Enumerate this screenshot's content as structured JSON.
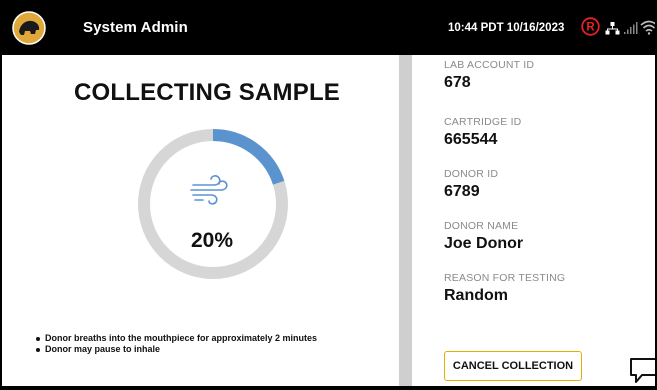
{
  "header": {
    "title": "System Admin",
    "datetime": "10:44 PDT 10/16/2023",
    "status_badge": "R",
    "icons": [
      "logo-icon",
      "registered-status-icon",
      "network-icon",
      "signal-icon",
      "wifi-icon"
    ],
    "colors": {
      "bar": "#000000",
      "badge": "#e52222"
    }
  },
  "collection": {
    "heading": "COLLECTING SAMPLE",
    "progress": 0.2,
    "progress_label": "20%",
    "ring_colors": {
      "fill": "#5b93cf",
      "track": "#d6d6d6"
    },
    "icon": "breath-wind-icon",
    "instructions": [
      "Donor breaths into the mouthpiece for approximately 2 minutes",
      "Donor may pause to inhale"
    ]
  },
  "details": [
    {
      "label": "LAB ACCOUNT ID",
      "value": "678"
    },
    {
      "label": "CARTRIDGE ID",
      "value": "665544"
    },
    {
      "label": "DONOR ID",
      "value": "6789"
    },
    {
      "label": "DONOR NAME",
      "value": "Joe Donor"
    },
    {
      "label": "REASON FOR TESTING",
      "value": "Random"
    }
  ],
  "actions": {
    "cancel_label": "CANCEL COLLECTION",
    "cancel_border_color": "#e2b100",
    "chat_icon": "chat-icon"
  }
}
